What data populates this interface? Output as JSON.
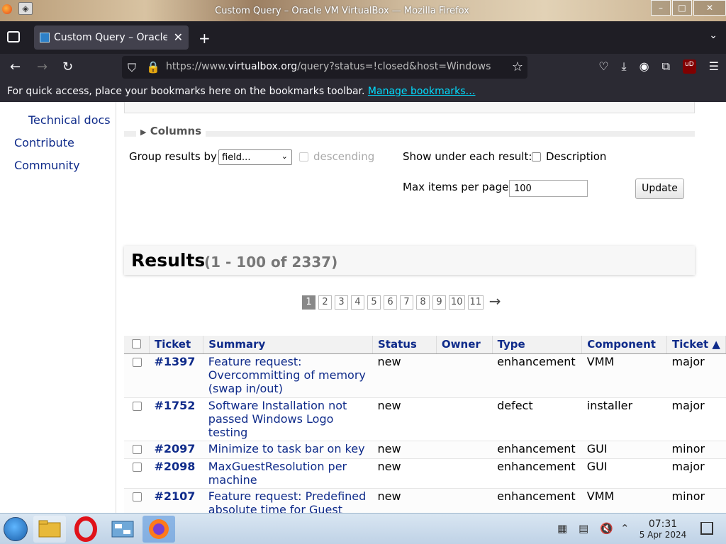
{
  "window": {
    "title": "Custom Query – Oracle VM VirtualBox — Mozilla Firefox",
    "controls": [
      "–",
      "□",
      "✕"
    ]
  },
  "browser": {
    "tab_title": "Custom Query – Oracle VM VirtualBox",
    "url_prefix": "https://www.",
    "url_domain": "virtualbox.org",
    "url_rest": "/query?status=!closed&host=Windows",
    "bookmarks_prompt": "For quick access, place your bookmarks here on the bookmarks toolbar.",
    "bookmarks_link": "Manage bookmarks…",
    "ublock_badge": "uD"
  },
  "sidebar": {
    "items": [
      {
        "label": "Technical docs"
      },
      {
        "label": "Contribute"
      },
      {
        "label": "Community"
      }
    ]
  },
  "filters": {
    "columns_label": "Columns",
    "group_by_label": "Group results by",
    "group_by_value": "field...",
    "descending_label": "descending",
    "show_under_label": "Show under each result:",
    "description_label": "Description",
    "max_items_label": "Max items per page",
    "max_items_value": "100",
    "update_label": "Update"
  },
  "results": {
    "heading": "Results",
    "count": "(1 - 100 of 2337)",
    "pages": [
      "1",
      "2",
      "3",
      "4",
      "5",
      "6",
      "7",
      "8",
      "9",
      "10",
      "11"
    ],
    "current_page": "1",
    "next_arrow": "→"
  },
  "table": {
    "headers": {
      "ticket": "Ticket",
      "summary": "Summary",
      "status": "Status",
      "owner": "Owner",
      "type": "Type",
      "component": "Component",
      "priority": "Ticket ▲"
    },
    "rows": [
      {
        "id": "#1397",
        "summary": "Feature request: Overcommitting of memory (swap in/out)",
        "status": "new",
        "owner": "",
        "type": "enhancement",
        "component": "VMM",
        "priority": "major"
      },
      {
        "id": "#1752",
        "summary": "Software Installation not passed Windows Logo testing",
        "status": "new",
        "owner": "",
        "type": "defect",
        "component": "installer",
        "priority": "major"
      },
      {
        "id": "#2097",
        "summary": "Minimize to task bar on key",
        "status": "new",
        "owner": "",
        "type": "enhancement",
        "component": "GUI",
        "priority": "minor"
      },
      {
        "id": "#2098",
        "summary": "MaxGuestResolution per machine",
        "status": "new",
        "owner": "",
        "type": "enhancement",
        "component": "GUI",
        "priority": "major"
      },
      {
        "id": "#2107",
        "summary": "Feature request: Predefined absolute time for Guest",
        "status": "new",
        "owner": "",
        "type": "enhancement",
        "component": "VMM",
        "priority": "minor"
      }
    ]
  },
  "taskbar": {
    "time": "07:31",
    "date": "5 Apr 2024",
    "apps": [
      "file-manager-icon",
      "opera-icon",
      "control-panel-icon",
      "firefox-icon"
    ]
  }
}
